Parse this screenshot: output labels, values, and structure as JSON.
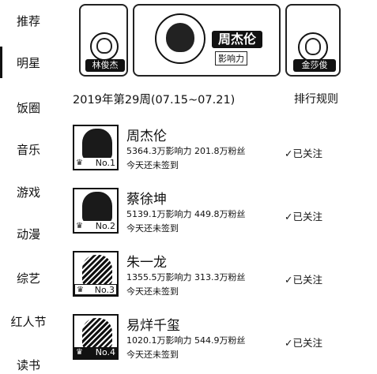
{
  "sidebar": {
    "items": [
      {
        "label": "推荐"
      },
      {
        "label": "明星"
      },
      {
        "label": "饭圈"
      },
      {
        "label": "音乐"
      },
      {
        "label": "游戏"
      },
      {
        "label": "动漫"
      },
      {
        "label": "综艺"
      },
      {
        "label": "红人节"
      },
      {
        "label": "读书"
      }
    ],
    "active_index": 1
  },
  "carousel": {
    "center": {
      "name": "周杰伦",
      "sub": "影响力"
    },
    "left": {
      "name": "林俊杰"
    },
    "right": {
      "name": "金莎俊"
    }
  },
  "week_header": {
    "title": "2019年第29周(07.15~07.21)",
    "rule_link": "排行规则"
  },
  "ranking": [
    {
      "rank": "No.1",
      "name": "周杰伦",
      "stats": "5364.3万影响力 201.8万粉丝",
      "checkin": "今天还未签到",
      "follow": "✓已关注"
    },
    {
      "rank": "No.2",
      "name": "蔡徐坤",
      "stats": "5139.1万影响力 449.8万粉丝",
      "checkin": "今天还未签到",
      "follow": "✓已关注"
    },
    {
      "rank": "No.3",
      "name": "朱一龙",
      "stats": "1355.5万影响力 313.3万粉丝",
      "checkin": "今天还未签到",
      "follow": "✓已关注"
    },
    {
      "rank": "No.4",
      "name": "易烊千玺",
      "stats": "1020.1万影响力 544.9万粉丝",
      "checkin": "今天还未签到",
      "follow": "✓已关注"
    }
  ]
}
